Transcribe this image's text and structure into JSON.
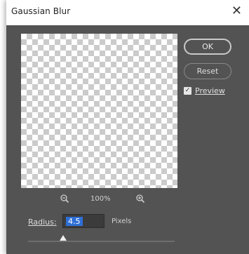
{
  "window": {
    "title": "Gaussian Blur"
  },
  "buttons": {
    "ok": "OK",
    "reset": "Reset"
  },
  "preview": {
    "label": "Preview",
    "checked": true
  },
  "zoom": {
    "level": "100%"
  },
  "radius": {
    "label": "Radius:",
    "value": "4.5",
    "units": "Pixels",
    "slider_fraction": 0.24
  },
  "icons": {
    "close": "close-icon",
    "zoom_out": "zoom-out-icon",
    "zoom_in": "zoom-in-icon",
    "check": "checkmark-icon"
  },
  "colors": {
    "dialog_bg": "#535353",
    "selection": "#2f6fd6"
  }
}
